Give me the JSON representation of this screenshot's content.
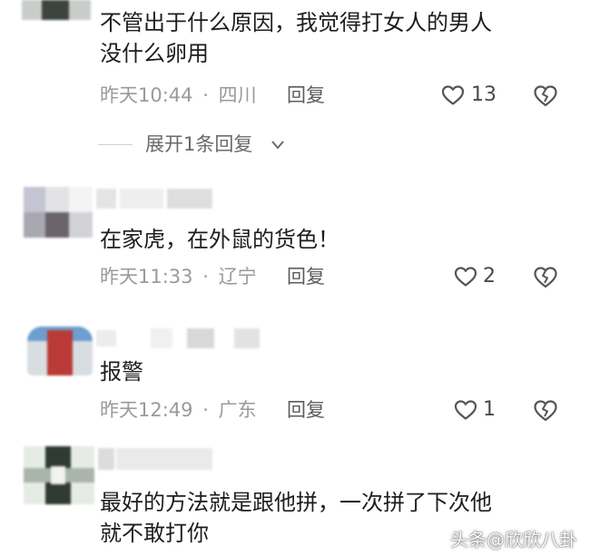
{
  "comments": [
    {
      "text_lines": [
        "不管出于什么原因，我觉得打女人的男人",
        "没什么卵用"
      ],
      "time": "昨天10:44",
      "location": "四川",
      "reply_label": "回复",
      "likes": "13",
      "expand_label": "展开1条回复"
    },
    {
      "text_lines": [
        "在家虎，在外鼠的货色！"
      ],
      "time": "昨天11:33",
      "location": "辽宁",
      "reply_label": "回复",
      "likes": "2"
    },
    {
      "text_lines": [
        "报警"
      ],
      "time": "昨天12:49",
      "location": "广东",
      "reply_label": "回复",
      "likes": "1"
    },
    {
      "text_lines": [
        "最好的方法就是跟他拼，一次拼了下次他",
        "就不敢打你"
      ]
    }
  ],
  "separator": "·",
  "watermark": "头条@欣欣八卦",
  "icons": {
    "like": "heart-outline-icon",
    "dislike": "broken-heart-icon",
    "expand": "chevron-down-icon"
  },
  "colors": {
    "meta": "#9a9a9a",
    "text": "#1d1d1d",
    "icon": "#555555"
  }
}
